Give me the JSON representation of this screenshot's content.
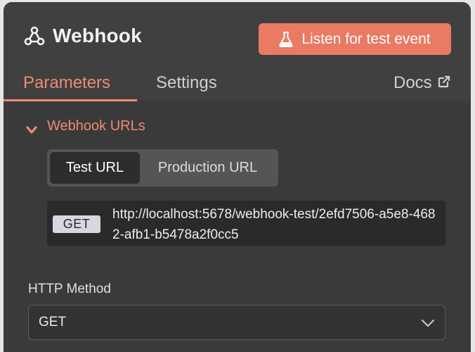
{
  "node": {
    "title": "Webhook",
    "icon": "webhook-icon"
  },
  "header": {
    "listen_button": "Listen for test event",
    "listen_icon": "flask-icon",
    "accent_color": "#ea7a64"
  },
  "tabs": [
    {
      "label": "Parameters",
      "active": true
    },
    {
      "label": "Settings",
      "active": false
    },
    {
      "label": "Docs",
      "active": false,
      "icon": "external-link-icon"
    }
  ],
  "section": {
    "label": "Webhook URLs",
    "expanded": true
  },
  "url_toggle": {
    "options": [
      "Test URL",
      "Production URL"
    ],
    "selected": "Test URL"
  },
  "url": {
    "method": "GET",
    "value": "http://localhost:5678/webhook-test/2efd7506-a5e8-4682-afb1-b5478a2f0cc5"
  },
  "http_method": {
    "label": "HTTP Method",
    "value": "GET"
  }
}
